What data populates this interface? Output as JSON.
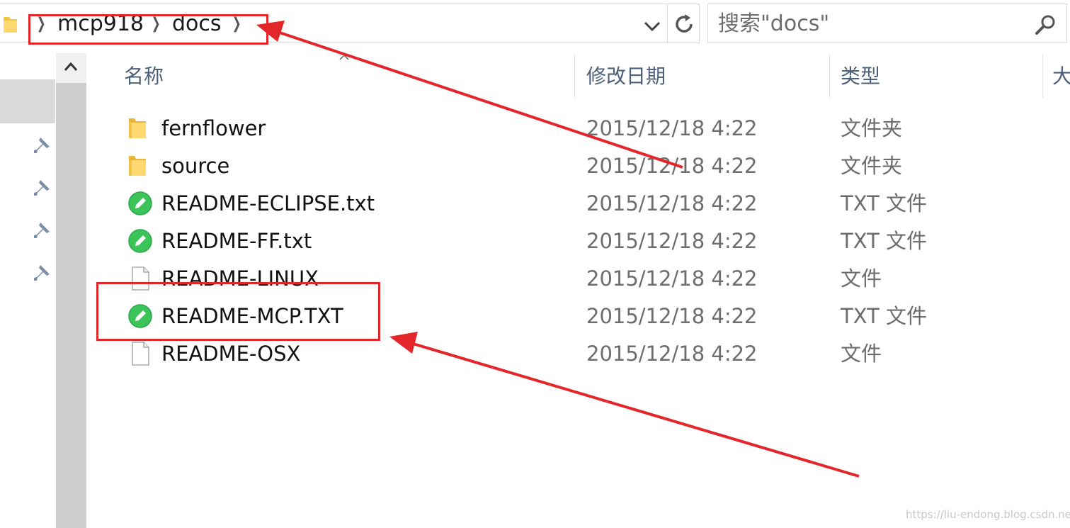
{
  "address_bar": {
    "breadcrumbs": [
      "mcp918",
      "docs"
    ],
    "dropdown_icon": "chevron-down-icon",
    "refresh_icon": "refresh-icon"
  },
  "search": {
    "placeholder": "搜索\"docs\"",
    "icon": "search-icon"
  },
  "columns": {
    "name": "名称",
    "date": "修改日期",
    "type": "类型",
    "size": "大"
  },
  "files": [
    {
      "name": "fernflower",
      "date": "2015/12/18 4:22",
      "type": "文件夹",
      "icon": "folder-icon"
    },
    {
      "name": "source",
      "date": "2015/12/18 4:22",
      "type": "文件夹",
      "icon": "folder-icon"
    },
    {
      "name": "README-ECLIPSE.txt",
      "date": "2015/12/18 4:22",
      "type": "TXT 文件",
      "icon": "notepad-txt-icon"
    },
    {
      "name": "README-FF.txt",
      "date": "2015/12/18 4:22",
      "type": "TXT 文件",
      "icon": "notepad-txt-icon"
    },
    {
      "name": "README-LINUX",
      "date": "2015/12/18 4:22",
      "type": "文件",
      "icon": "blank-file-icon"
    },
    {
      "name": "README-MCP.TXT",
      "date": "2015/12/18 4:22",
      "type": "TXT 文件",
      "icon": "notepad-txt-icon"
    },
    {
      "name": "README-OSX",
      "date": "2015/12/18 4:22",
      "type": "文件",
      "icon": "blank-file-icon"
    }
  ],
  "nav": {
    "pins": [
      "pin-icon",
      "pin-icon",
      "pin-icon",
      "pin-icon"
    ]
  },
  "colors": {
    "annotation": "#e3262a",
    "header_text": "#4c607a",
    "folder": "#f4c542",
    "txt_icon": "#3cc35a"
  },
  "watermark": "https://liu-endong.blog.csdn.net"
}
